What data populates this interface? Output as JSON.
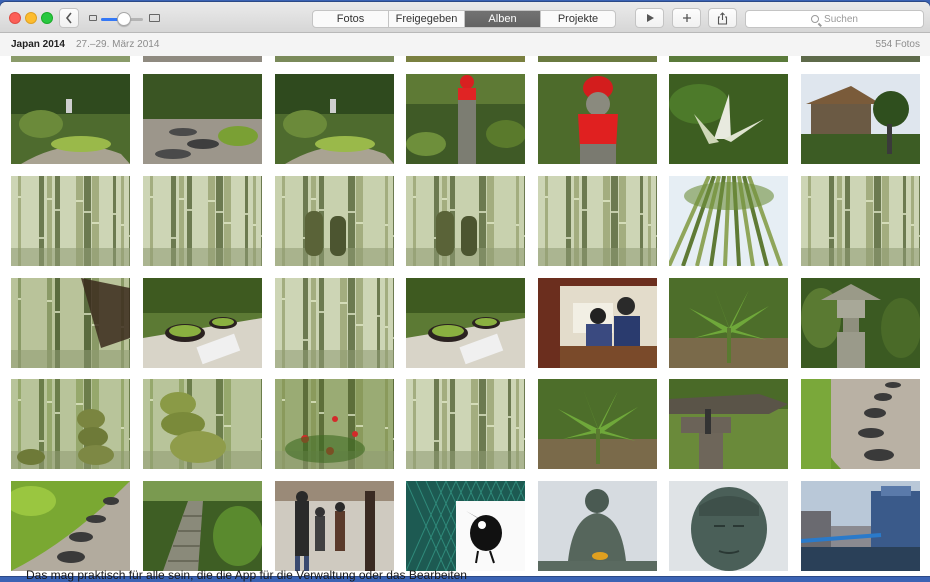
{
  "window": {
    "album_title": "Japan 2014",
    "album_dates": "27.–29. März 2014",
    "photo_count": "554 Fotos"
  },
  "toolbar": {
    "back_icon": "chevron-left-icon",
    "tabs": [
      {
        "label": "Fotos",
        "active": false
      },
      {
        "label": "Freigegeben",
        "active": false
      },
      {
        "label": "Alben",
        "active": true
      },
      {
        "label": "Projekte",
        "active": false
      }
    ],
    "play_icon": "play-icon",
    "add_icon": "plus-icon",
    "share_icon": "share-icon",
    "search_placeholder": "Suchen"
  },
  "background_text": "Das mag praktisch für alle sein, die die App für die Verwaltung oder das Bearbeiten",
  "colors": {
    "accent": "#3478f6",
    "desktop": "#3b63b4",
    "active_tab": "#6a6a6a"
  },
  "photos": [
    {
      "name": "zen-garden-path",
      "kind": "garden"
    },
    {
      "name": "zen-garden-stones",
      "kind": "stones"
    },
    {
      "name": "garden-statue",
      "kind": "garden"
    },
    {
      "name": "jizo-red-hat",
      "kind": "jizo"
    },
    {
      "name": "jizo-red-bib",
      "kind": "jizo-close"
    },
    {
      "name": "agave-plant",
      "kind": "plant"
    },
    {
      "name": "temple-roof",
      "kind": "temple"
    },
    {
      "name": "bamboo-grove-1",
      "kind": "bamboo"
    },
    {
      "name": "bamboo-grove-2",
      "kind": "bamboo"
    },
    {
      "name": "bamboo-statues",
      "kind": "bamboo-statue"
    },
    {
      "name": "bamboo-jizo",
      "kind": "bamboo-statue"
    },
    {
      "name": "bamboo-grove-3",
      "kind": "bamboo"
    },
    {
      "name": "bamboo-sky",
      "kind": "bamboo-sky"
    },
    {
      "name": "bamboo-grove-4",
      "kind": "bamboo"
    },
    {
      "name": "bamboo-pavilion",
      "kind": "bamboo-dark"
    },
    {
      "name": "matcha-bowls-1",
      "kind": "tea"
    },
    {
      "name": "bamboo-moss",
      "kind": "bamboo"
    },
    {
      "name": "matcha-bowls-2",
      "kind": "tea"
    },
    {
      "name": "tea-house-staff",
      "kind": "people-indoor"
    },
    {
      "name": "palm-leaves",
      "kind": "palm"
    },
    {
      "name": "stone-lantern",
      "kind": "lantern"
    },
    {
      "name": "bamboo-rocks",
      "kind": "bamboo-rocks"
    },
    {
      "name": "stacked-stones",
      "kind": "stones-stack"
    },
    {
      "name": "camellia-bamboo",
      "kind": "bamboo-flowers"
    },
    {
      "name": "bamboo-forest-light",
      "kind": "bamboo"
    },
    {
      "name": "green-fern-plant",
      "kind": "palm"
    },
    {
      "name": "tree-trunk-tied",
      "kind": "trunk"
    },
    {
      "name": "stepping-stones",
      "kind": "stepping"
    },
    {
      "name": "moss-path",
      "kind": "moss-path"
    },
    {
      "name": "stone-stairs",
      "kind": "stairs"
    },
    {
      "name": "street-people",
      "kind": "street"
    },
    {
      "name": "bird-sign",
      "kind": "bird"
    },
    {
      "name": "great-buddha-1",
      "kind": "buddha"
    },
    {
      "name": "great-buddha-2",
      "kind": "buddha-close"
    },
    {
      "name": "river-city",
      "kind": "city"
    }
  ]
}
